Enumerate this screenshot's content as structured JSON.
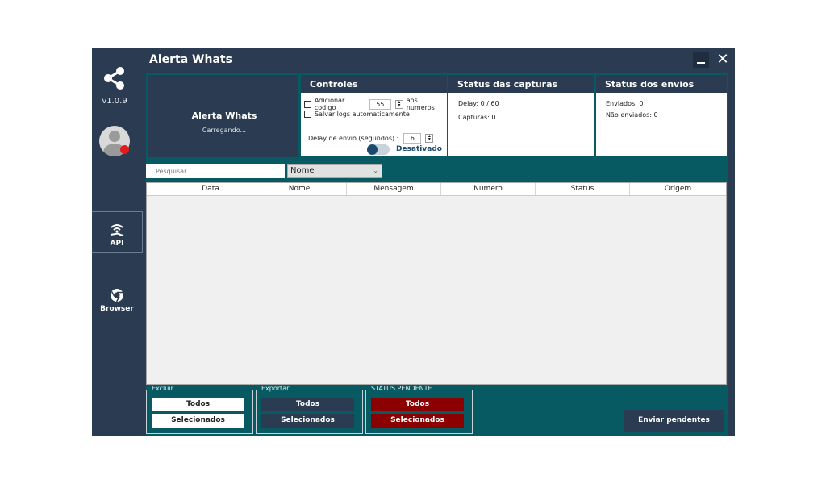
{
  "app": {
    "title": "Alerta Whats",
    "version": "v1.0.9",
    "name": "Alerta Whats",
    "loading_text": "Carregando..."
  },
  "sidebar": {
    "api_label": "API",
    "browser_label": "Browser"
  },
  "controls": {
    "header": "Controles",
    "add_code_label": "Adicionar codigo",
    "add_code_value": "55",
    "add_code_suffix": "aos numeros",
    "save_logs_label": "Salvar logs automaticamente",
    "delay_label": "Delay  de envio (segundos) :",
    "delay_value": "6",
    "toggle_label": "Desativado"
  },
  "captures": {
    "header": "Status das capturas",
    "delay_text": "Delay: 0   /    60",
    "captures_text": "Capturas: 0"
  },
  "sends": {
    "header": "Status dos envios",
    "sent_text": "Enviados: 0",
    "not_sent_text": "Não enviados: 0"
  },
  "filter": {
    "search_placeholder": "Pesquisar",
    "select_value": "Nome"
  },
  "table": {
    "columns": [
      "Data",
      "Nome",
      "Mensagem",
      "Numero",
      "Status",
      "Origem"
    ]
  },
  "groups": {
    "excluir": {
      "legend": "Excluir",
      "all": "Todos",
      "selected": "Selecionados"
    },
    "exportar": {
      "legend": "Exportar",
      "all": "Todos",
      "selected": "Selecionados"
    },
    "pendente": {
      "legend": "STATUS PENDENTE",
      "all": "Todos",
      "selected": "Selecionados"
    }
  },
  "send_pending_label": "Enviar pendentes",
  "colors": {
    "navy": "#2a3b52",
    "teal": "#075962",
    "red": "#8b0000",
    "toggle_knob": "#1a4a6e"
  },
  "icons": {
    "share": "share-icon",
    "api": "wifi-hand-icon",
    "browser": "chrome-icon",
    "minimize": "minimize-icon",
    "close": "close-icon"
  }
}
